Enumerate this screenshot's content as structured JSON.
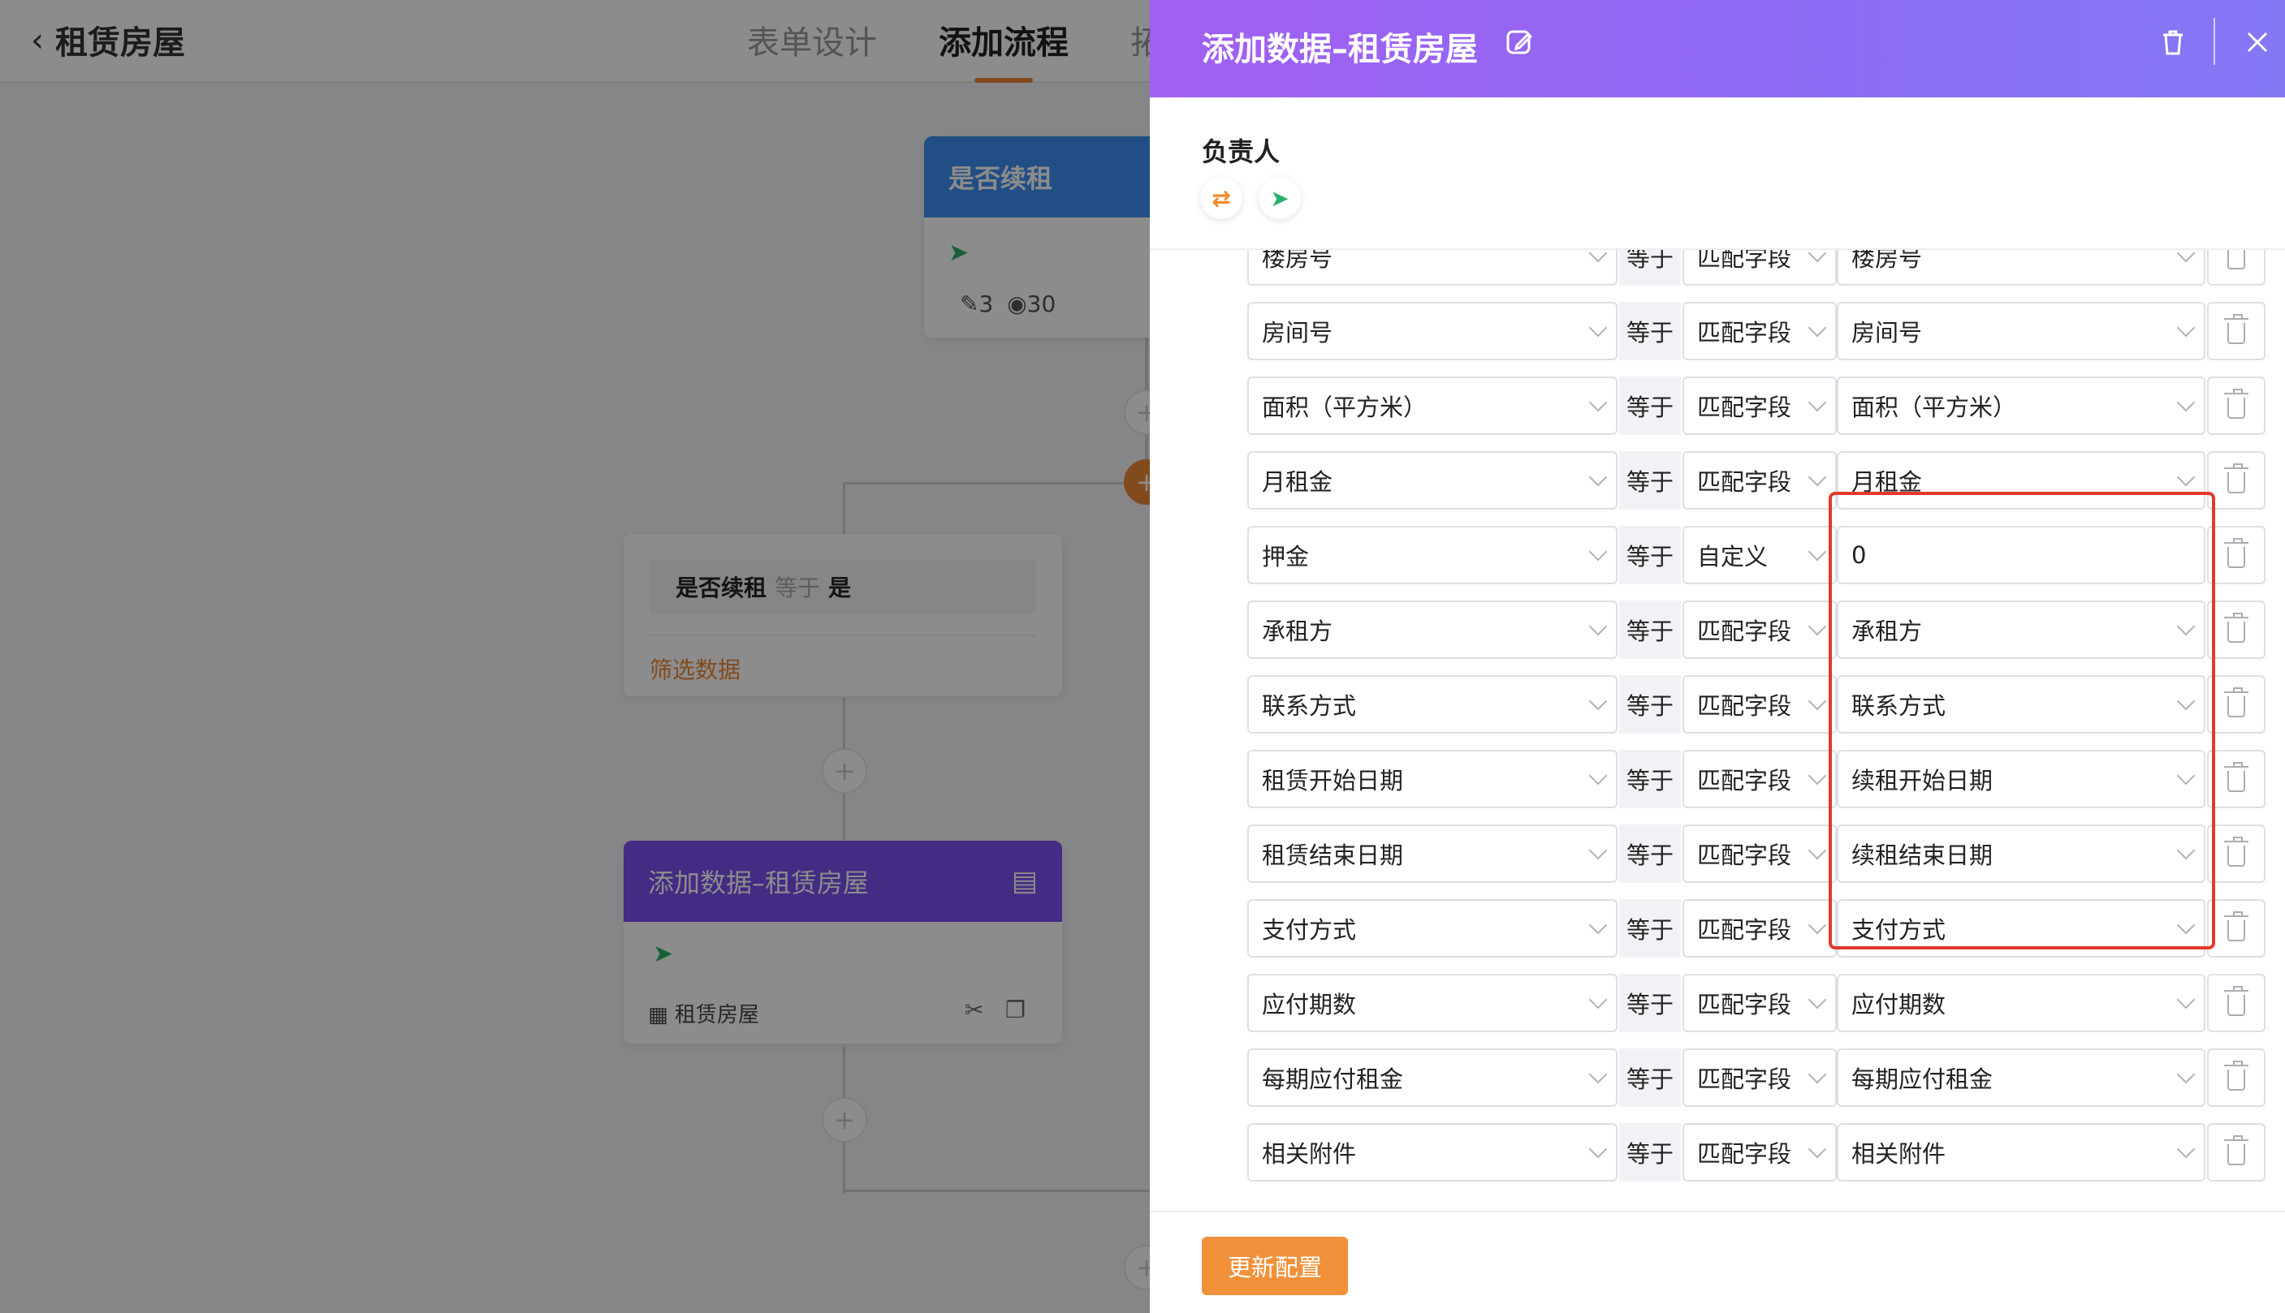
{
  "app": {
    "title": "租赁房屋"
  },
  "tabs": [
    {
      "label": "表单设计"
    },
    {
      "label": "添加流程"
    },
    {
      "label": "拓"
    }
  ],
  "flow": {
    "node_renew": {
      "title": "是否续租",
      "edit_count": "3",
      "view_count": "30"
    },
    "filter_node": {
      "condition_field": "是否续租",
      "condition_op": "等于",
      "condition_value": "是",
      "footer": "筛选数据"
    },
    "add_node": {
      "title": "添加数据–租赁房屋",
      "table_name": "租赁房屋"
    },
    "plus": "+"
  },
  "drawer": {
    "title": "添加数据–租赁房屋",
    "owner_label": "负责人",
    "rows": [
      {
        "field": "楼房号",
        "op": "等于",
        "mode": "匹配字段",
        "value": "楼房号"
      },
      {
        "field": "房间号",
        "op": "等于",
        "mode": "匹配字段",
        "value": "房间号"
      },
      {
        "field": "面积（平方米）",
        "op": "等于",
        "mode": "匹配字段",
        "value": "面积（平方米）"
      },
      {
        "field": "月租金",
        "op": "等于",
        "mode": "匹配字段",
        "value": "月租金"
      },
      {
        "field": "押金",
        "op": "等于",
        "mode": "自定义",
        "value": "0"
      },
      {
        "field": "承租方",
        "op": "等于",
        "mode": "匹配字段",
        "value": "承租方"
      },
      {
        "field": "联系方式",
        "op": "等于",
        "mode": "匹配字段",
        "value": "联系方式"
      },
      {
        "field": "租赁开始日期",
        "op": "等于",
        "mode": "匹配字段",
        "value": "续租开始日期"
      },
      {
        "field": "租赁结束日期",
        "op": "等于",
        "mode": "匹配字段",
        "value": "续租结束日期"
      },
      {
        "field": "支付方式",
        "op": "等于",
        "mode": "匹配字段",
        "value": "支付方式"
      },
      {
        "field": "应付期数",
        "op": "等于",
        "mode": "匹配字段",
        "value": "应付期数"
      },
      {
        "field": "每期应付租金",
        "op": "等于",
        "mode": "匹配字段",
        "value": "每期应付租金"
      },
      {
        "field": "相关附件",
        "op": "等于",
        "mode": "匹配字段",
        "value": "相关附件"
      }
    ],
    "update_button": "更新配置"
  },
  "colors": {
    "header_gradient_start": "#a25ff2",
    "header_gradient_end": "#8478f5",
    "accent": "#f0913a",
    "highlight": "#e23a2b"
  }
}
